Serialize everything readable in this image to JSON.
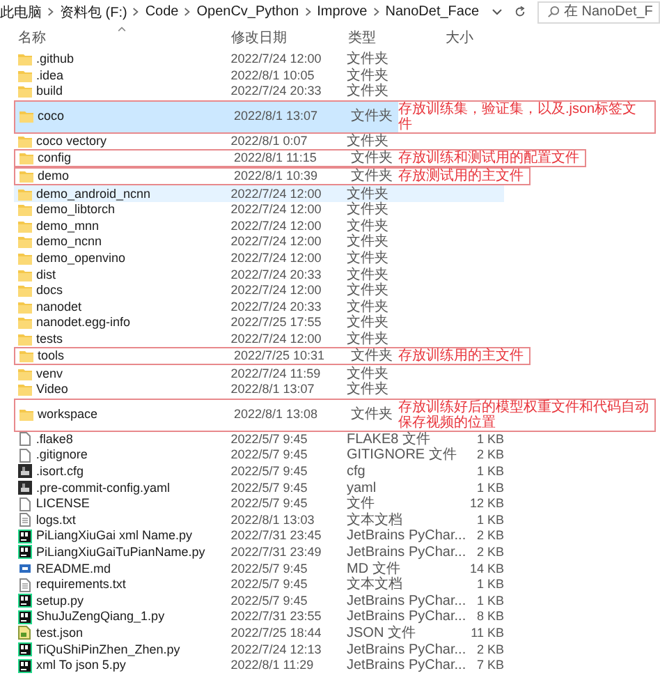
{
  "address_bar": {
    "crumbs": [
      "此电脑",
      "资料包 (F:)",
      "Code",
      "OpenCv_Python",
      "Improve",
      "NanoDet_Face"
    ]
  },
  "search": {
    "placeholder": "在 NanoDet_F"
  },
  "columns": [
    "名称",
    "修改日期",
    "类型",
    "大小"
  ],
  "rows": [
    {
      "kind": "folder",
      "name": ".github",
      "date": "2022/7/24 12:00",
      "type": "文件夹",
      "selected": false,
      "hovered": false
    },
    {
      "kind": "folder",
      "name": ".idea",
      "date": "2022/8/1 10:05",
      "type": "文件夹",
      "selected": false,
      "hovered": false
    },
    {
      "kind": "folder",
      "name": "build",
      "date": "2022/7/24 20:33",
      "type": "文件夹",
      "selected": false,
      "hovered": false
    },
    {
      "kind": "folder",
      "name": "coco",
      "date": "2022/8/1 13:07",
      "type": "文件夹",
      "selected": true,
      "hovered": false,
      "note": "存放训练集，验证集，以及.json标签文件"
    },
    {
      "kind": "folder",
      "name": "coco vectory",
      "date": "2022/8/1 0:07",
      "type": "文件夹",
      "selected": false,
      "hovered": false
    },
    {
      "kind": "folder",
      "name": "config",
      "date": "2022/8/1 11:15",
      "type": "文件夹",
      "selected": false,
      "hovered": false,
      "note": "存放训练和测试用的配置文件"
    },
    {
      "kind": "folder",
      "name": "demo",
      "date": "2022/8/1 10:39",
      "type": "文件夹",
      "selected": false,
      "hovered": false,
      "note": "存放测试用的主文件"
    },
    {
      "kind": "folder",
      "name": "demo_android_ncnn",
      "date": "2022/7/24 12:00",
      "type": "文件夹",
      "selected": false,
      "hovered": true
    },
    {
      "kind": "folder",
      "name": "demo_libtorch",
      "date": "2022/7/24 12:00",
      "type": "文件夹",
      "selected": false,
      "hovered": false
    },
    {
      "kind": "folder",
      "name": "demo_mnn",
      "date": "2022/7/24 12:00",
      "type": "文件夹",
      "selected": false,
      "hovered": false
    },
    {
      "kind": "folder",
      "name": "demo_ncnn",
      "date": "2022/7/24 12:00",
      "type": "文件夹",
      "selected": false,
      "hovered": false
    },
    {
      "kind": "folder",
      "name": "demo_openvino",
      "date": "2022/7/24 12:00",
      "type": "文件夹",
      "selected": false,
      "hovered": false
    },
    {
      "kind": "folder",
      "name": "dist",
      "date": "2022/7/24 20:33",
      "type": "文件夹",
      "selected": false,
      "hovered": false
    },
    {
      "kind": "folder",
      "name": "docs",
      "date": "2022/7/24 12:00",
      "type": "文件夹",
      "selected": false,
      "hovered": false
    },
    {
      "kind": "folder",
      "name": "nanodet",
      "date": "2022/7/24 20:33",
      "type": "文件夹",
      "selected": false,
      "hovered": false
    },
    {
      "kind": "folder",
      "name": "nanodet.egg-info",
      "date": "2022/7/25 17:55",
      "type": "文件夹",
      "selected": false,
      "hovered": false
    },
    {
      "kind": "folder",
      "name": "tests",
      "date": "2022/7/24 12:00",
      "type": "文件夹",
      "selected": false,
      "hovered": false
    },
    {
      "kind": "folder",
      "name": "tools",
      "date": "2022/7/25 10:31",
      "type": "文件夹",
      "selected": false,
      "hovered": false,
      "note": "存放训练用的主文件"
    },
    {
      "kind": "folder",
      "name": "venv",
      "date": "2022/7/24 11:59",
      "type": "文件夹",
      "selected": false,
      "hovered": false
    },
    {
      "kind": "folder",
      "name": "Video",
      "date": "2022/8/1 13:07",
      "type": "文件夹",
      "selected": false,
      "hovered": false
    },
    {
      "kind": "folder",
      "name": "workspace",
      "date": "2022/8/1 13:08",
      "type": "文件夹",
      "selected": false,
      "hovered": false,
      "note": "存放训练好后的模型权重文件和代码自动保存视频的位置"
    },
    {
      "kind": "file",
      "name": ".flake8",
      "date": "2022/5/7 9:45",
      "type": "FLAKE8 文件",
      "size": "1 KB",
      "selected": false,
      "hovered": false
    },
    {
      "kind": "file",
      "name": ".gitignore",
      "date": "2022/5/7 9:45",
      "type": "GITIGNORE 文件",
      "size": "2 KB",
      "selected": false,
      "hovered": false
    },
    {
      "kind": "app",
      "name": ".isort.cfg",
      "date": "2022/5/7 9:45",
      "type": "cfg",
      "size": "1 KB",
      "selected": false,
      "hovered": false
    },
    {
      "kind": "app",
      "name": ".pre-commit-config.yaml",
      "date": "2022/5/7 9:45",
      "type": "yaml",
      "size": "1 KB",
      "selected": false,
      "hovered": false
    },
    {
      "kind": "file",
      "name": "LICENSE",
      "date": "2022/5/7 9:45",
      "type": "文件",
      "size": "12 KB",
      "selected": false,
      "hovered": false
    },
    {
      "kind": "text",
      "name": "logs.txt",
      "date": "2022/8/1 13:03",
      "type": "文本文档",
      "size": "1 KB",
      "selected": false,
      "hovered": false
    },
    {
      "kind": "pycharm",
      "name": "PiLiangXiuGai xml Name.py",
      "date": "2022/7/31 23:45",
      "type": "JetBrains PyChar...",
      "size": "2 KB",
      "selected": false,
      "hovered": false
    },
    {
      "kind": "pycharm",
      "name": "PiLiangXiuGaiTuPianName.py",
      "date": "2022/7/31 23:49",
      "type": "JetBrains PyChar...",
      "size": "2 KB",
      "selected": false,
      "hovered": false
    },
    {
      "kind": "markdown",
      "name": "README.md",
      "date": "2022/5/7 9:45",
      "type": "MD 文件",
      "size": "14 KB",
      "selected": false,
      "hovered": false
    },
    {
      "kind": "text",
      "name": "requirements.txt",
      "date": "2022/5/7 9:45",
      "type": "文本文档",
      "size": "1 KB",
      "selected": false,
      "hovered": false
    },
    {
      "kind": "pycharm",
      "name": "setup.py",
      "date": "2022/5/7 9:45",
      "type": "JetBrains PyChar...",
      "size": "1 KB",
      "selected": false,
      "hovered": false
    },
    {
      "kind": "pycharm",
      "name": "ShuJuZengQiang_1.py",
      "date": "2022/7/31 23:55",
      "type": "JetBrains PyChar...",
      "size": "8 KB",
      "selected": false,
      "hovered": false
    },
    {
      "kind": "json",
      "name": "test.json",
      "date": "2022/7/25 18:44",
      "type": "JSON 文件",
      "size": "11 KB",
      "selected": false,
      "hovered": false
    },
    {
      "kind": "pycharm",
      "name": "TiQuShiPinZhen_Zhen.py",
      "date": "2022/7/24 12:13",
      "type": "JetBrains PyChar...",
      "size": "2 KB",
      "selected": false,
      "hovered": false
    },
    {
      "kind": "pycharm",
      "name": "xml To json 5.py",
      "date": "2022/8/1 11:29",
      "type": "JetBrains PyChar...",
      "size": "7 KB",
      "selected": false,
      "hovered": false
    }
  ]
}
